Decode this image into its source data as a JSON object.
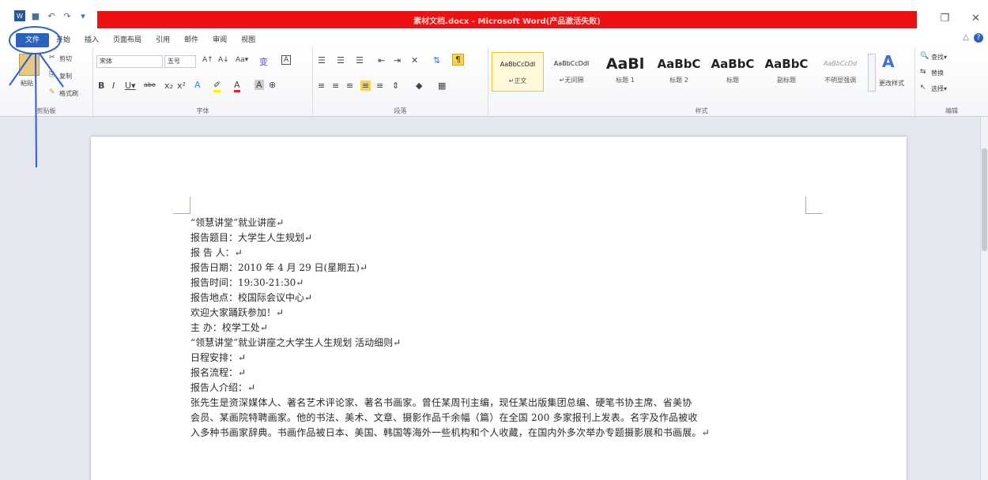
{
  "window": {
    "title": "素材文档.docx - Microsoft Word(产品激活失败)",
    "controls": {
      "restore": "❐",
      "close": "✕"
    }
  },
  "qat": {
    "save": "■",
    "undo": "↶",
    "redo": "↷",
    "more": "▾"
  },
  "tabs": [
    "文件",
    "开始",
    "插入",
    "页面布局",
    "引用",
    "邮件",
    "审阅",
    "视图"
  ],
  "help": {
    "minimize_ribbon": "△",
    "help": "?"
  },
  "clipboard": {
    "paste": "粘贴",
    "cut": "剪切",
    "copy": "复制",
    "format_painter": "格式刷",
    "label": "剪贴板"
  },
  "font": {
    "family": "宋体",
    "size": "五号",
    "label": "字体",
    "row1": [
      "A↑",
      "A↓",
      "Aa▾",
      "变",
      "A"
    ],
    "row2": [
      "B",
      "I",
      "U▾",
      "abe",
      "x₂",
      "x²"
    ]
  },
  "paragraph": {
    "label": "段落"
  },
  "styles": {
    "label": "样式",
    "items": [
      {
        "sample": "AaBbCcDdI",
        "name": "↵正文"
      },
      {
        "sample": "AaBbCcDdI",
        "name": "↵无间隔"
      },
      {
        "sample": "AaBl",
        "name": "标题 1"
      },
      {
        "sample": "AaBbC",
        "name": "标题 2"
      },
      {
        "sample": "AaBbC",
        "name": "标题"
      },
      {
        "sample": "AaBbC",
        "name": "副标题"
      },
      {
        "sample": "AaBbCcDd",
        "name": "不明显强调"
      }
    ],
    "change_styles": "更改样式"
  },
  "editing": {
    "find": "查找▾",
    "replace": "替换",
    "select": "选择▾",
    "label": "编辑"
  },
  "document": {
    "lines": [
      "“领慧讲堂”就业讲座↵",
      "报告题目：大学生人生规划↵",
      "报 告 人：↵",
      "报告日期：2010 年 4 月 29 日(星期五)↵",
      "报告时间：19:30-21:30↵",
      "报告地点：校国际会议中心↵",
      "欢迎大家踊跃参加！↵",
      "主 办：校学工处↵",
      "“领慧讲堂”就业讲座之大学生人生规划 活动细则↵",
      "日程安排：↵",
      "报名流程：↵",
      "报告人介绍：↵",
      "张先生是资深媒体人、著名艺术评论家、著名书画家。曾任某周刊主编，现任某出版集团总编、硬笔书协主席、省美协",
      "会员、某画院特聘画家。他的书法、美术、文章、摄影作品千余幅（篇）在全国 200 多家报刊上发表。名字及作品被收",
      "入多种书画家辞典。书画作品被日本、美国、韩国等海外一些机构和个人收藏，在国内外多次举办专题摄影展和书画展。↵"
    ]
  },
  "colors": {
    "title_strip": "#ee1111",
    "file_tab": "#2a62bd",
    "annotation": "#2f5fd6"
  }
}
